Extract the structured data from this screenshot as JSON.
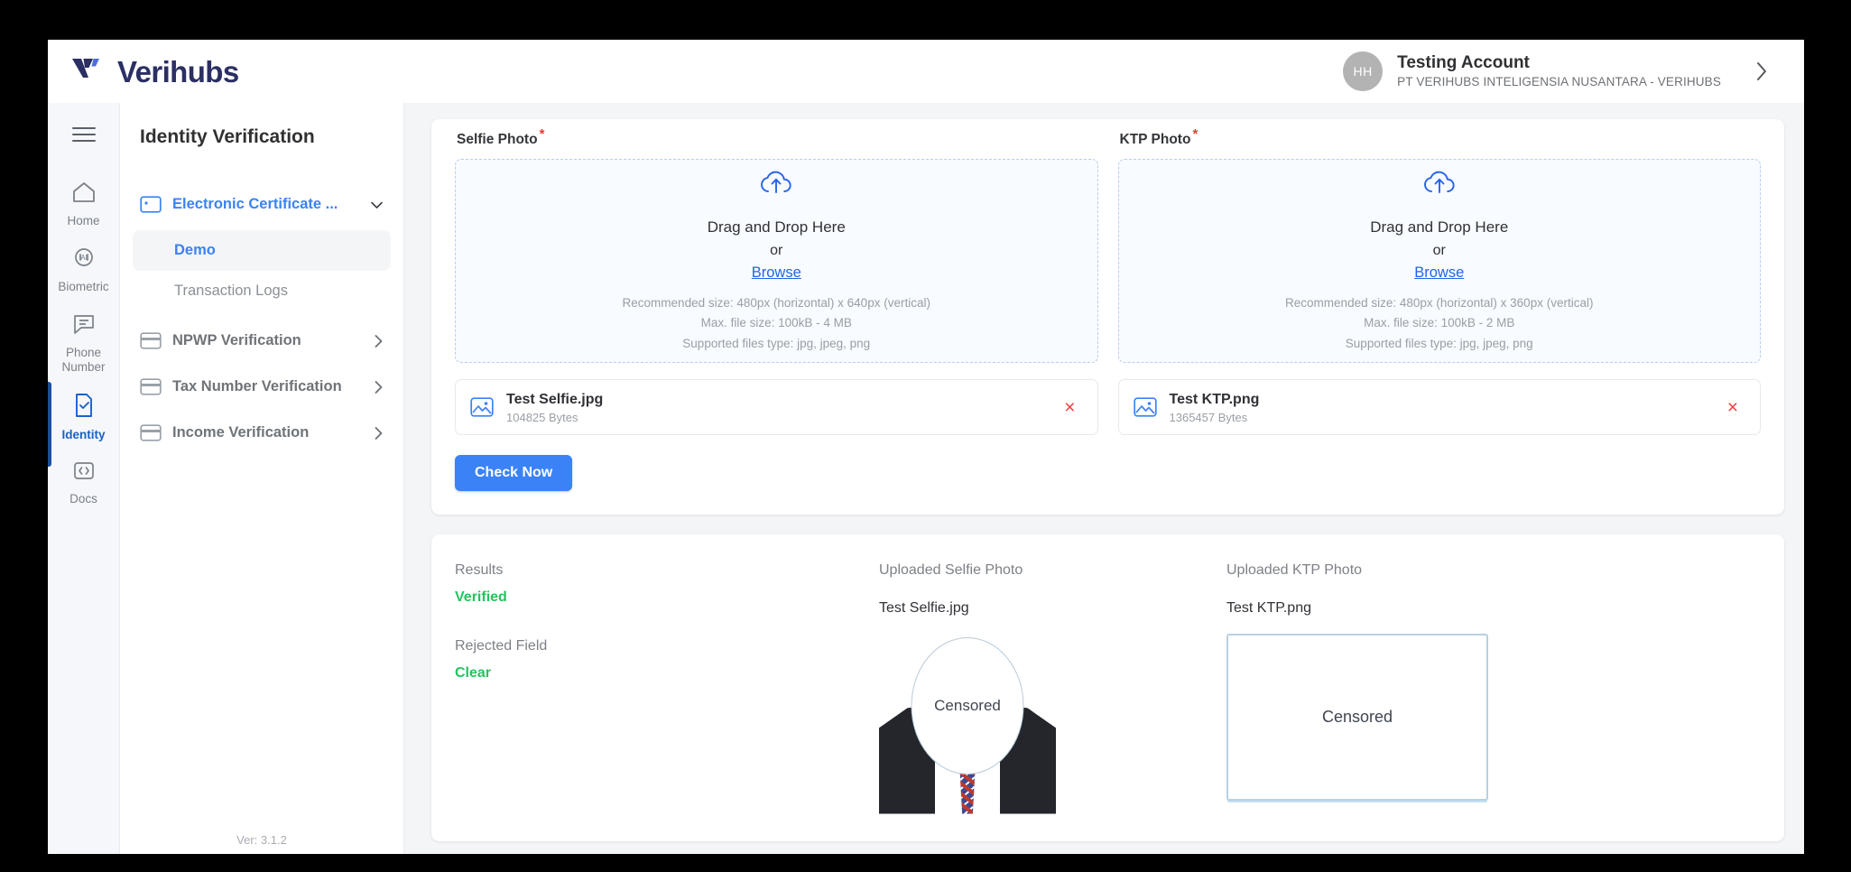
{
  "brand": {
    "name": "Verihubs"
  },
  "account": {
    "initials": "HH",
    "name": "Testing Account",
    "org": "PT VERIHUBS INTELIGENSIA NUSANTARA - VERIHUBS"
  },
  "rail": {
    "items": [
      {
        "label": "Home",
        "icon": "home-icon"
      },
      {
        "label": "Biometric",
        "icon": "biometric-ai-icon"
      },
      {
        "label": "Phone Number",
        "icon": "chat-bubble-icon"
      },
      {
        "label": "Identity",
        "icon": "document-check-icon"
      },
      {
        "label": "Docs",
        "icon": "code-brackets-icon"
      }
    ],
    "active_index": 3
  },
  "sidebar": {
    "title": "Identity Verification",
    "version": "Ver: 3.1.2",
    "groups": [
      {
        "label": "Electronic Certificate ...",
        "icon": "id-card-icon",
        "expanded": true,
        "children": [
          {
            "label": "Demo",
            "active": true
          },
          {
            "label": "Transaction Logs",
            "active": false
          }
        ]
      },
      {
        "label": "NPWP Verification",
        "icon": "card-icon",
        "expanded": false,
        "children": []
      },
      {
        "label": "Tax Number Verification",
        "icon": "card-icon",
        "expanded": false,
        "children": []
      },
      {
        "label": "Income Verification",
        "icon": "card-icon",
        "expanded": false,
        "children": []
      }
    ]
  },
  "upload": {
    "selfie": {
      "label": "Selfie Photo",
      "required_mark": "*",
      "drag_text": "Drag and Drop Here",
      "or_text": "or",
      "browse_text": "Browse",
      "hint_size": "Recommended size: 480px (horizontal) x 640px (vertical)",
      "hint_max": "Max. file size: 100kB - 4 MB",
      "hint_types": "Supported files type: jpg, jpeg, png",
      "file_name": "Test Selfie.jpg",
      "file_size": "104825 Bytes",
      "remove_label": "×"
    },
    "ktp": {
      "label": "KTP Photo",
      "required_mark": "*",
      "drag_text": "Drag and Drop Here",
      "or_text": "or",
      "browse_text": "Browse",
      "hint_size": "Recommended size: 480px (horizontal) x 360px (vertical)",
      "hint_max": "Max. file size: 100kB - 2 MB",
      "hint_types": "Supported files type: jpg, jpeg, png",
      "file_name": "Test KTP.png",
      "file_size": "1365457 Bytes",
      "remove_label": "×"
    },
    "submit_label": "Check Now"
  },
  "results": {
    "results_label": "Results",
    "results_value": "Verified",
    "rejected_label": "Rejected Field",
    "rejected_value": "Clear",
    "selfie_header": "Uploaded Selfie Photo",
    "selfie_filename": "Test Selfie.jpg",
    "selfie_censor": "Censored",
    "ktp_header": "Uploaded KTP Photo",
    "ktp_filename": "Test KTP.png",
    "ktp_censor": "Censored"
  },
  "colors": {
    "primary": "#3b82f6",
    "brand_navy": "#2b2f63",
    "success": "#22c55e",
    "danger": "#ef4444",
    "rail_active": "#1d4f9e"
  }
}
